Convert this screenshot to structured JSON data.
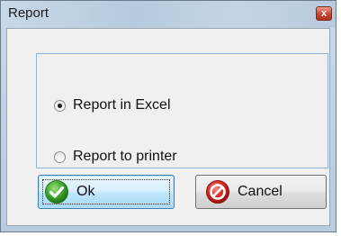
{
  "window": {
    "title": "Report",
    "close_glyph": "x"
  },
  "options": [
    {
      "label": "Report in Excel",
      "checked": true
    },
    {
      "label": "Report to printer",
      "checked": false
    }
  ],
  "buttons": {
    "ok_label": "Ok",
    "ok_icon": "green-checkmark-icon",
    "cancel_label": "Cancel",
    "cancel_icon": "red-prohibition-icon"
  },
  "colors": {
    "titlebar": "#c8d8ea",
    "ok_accent": "#3c7fb1",
    "check_green": "#3ea52e",
    "cancel_red": "#d4261f"
  }
}
